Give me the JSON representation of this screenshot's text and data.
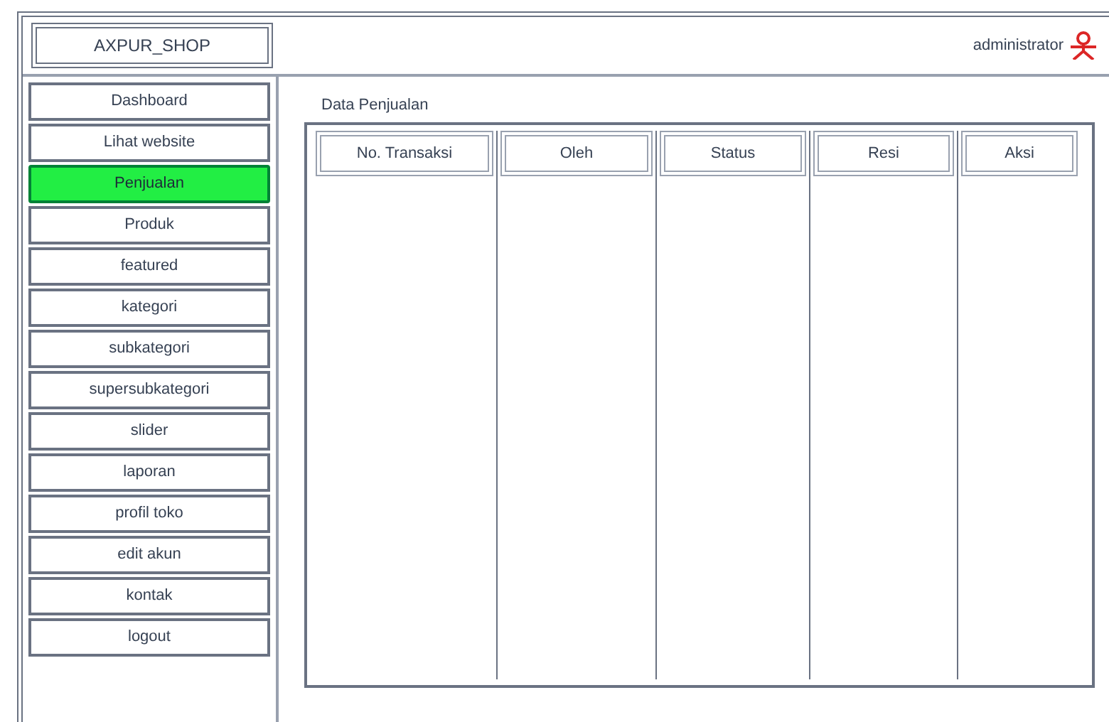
{
  "header": {
    "brand": "AXPUR_SHOP",
    "user": "administrator"
  },
  "sidebar": {
    "items": [
      {
        "label": "Dashboard",
        "selected": false
      },
      {
        "label": "Lihat website",
        "selected": false
      },
      {
        "label": "Penjualan",
        "selected": true
      },
      {
        "label": "Produk",
        "selected": false
      },
      {
        "label": "featured",
        "selected": false
      },
      {
        "label": "kategori",
        "selected": false
      },
      {
        "label": "subkategori",
        "selected": false
      },
      {
        "label": "supersubkategori",
        "selected": false
      },
      {
        "label": "slider",
        "selected": false
      },
      {
        "label": "laporan",
        "selected": false
      },
      {
        "label": "profil toko",
        "selected": false
      },
      {
        "label": "edit akun",
        "selected": false
      },
      {
        "label": "kontak",
        "selected": false
      },
      {
        "label": "logout",
        "selected": false
      }
    ]
  },
  "content": {
    "title": "Data Penjualan",
    "table": {
      "columns": [
        "No. Transaksi",
        "Oleh",
        "Status",
        "Resi",
        "Aksi"
      ]
    }
  }
}
